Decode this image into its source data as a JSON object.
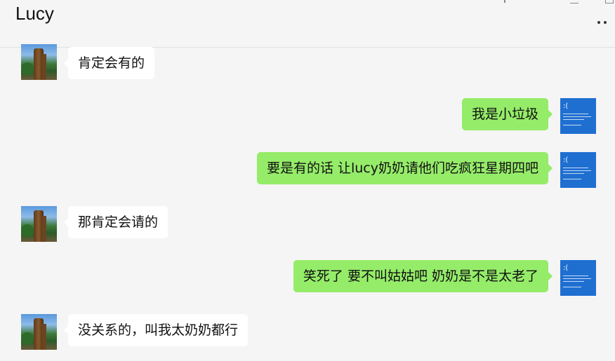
{
  "window": {
    "contact_name": "Lucy"
  },
  "header": {
    "more_icon": "more-dots-icon"
  },
  "messages": [
    {
      "side": "in",
      "text": "肯定会有的"
    },
    {
      "side": "out",
      "text": "我是小垃圾"
    },
    {
      "side": "out",
      "text": "要是有的话 让lucy奶奶请他们吃疯狂星期四吧"
    },
    {
      "side": "in",
      "text": "那肯定会请的"
    },
    {
      "side": "out",
      "text": "笑死了 要不叫姑姑吧 奶奶是不是太老了"
    },
    {
      "side": "in",
      "text": "没关系的，叫我太奶奶都行"
    }
  ],
  "avatars": {
    "contact": "tree-photo-avatar",
    "self": "blue-screen-avatar",
    "self_face": ":("
  },
  "colors": {
    "background": "#f5f5f5",
    "incoming_bubble": "#ffffff",
    "outgoing_bubble": "#95ec69",
    "self_avatar": "#1f6fd1"
  }
}
